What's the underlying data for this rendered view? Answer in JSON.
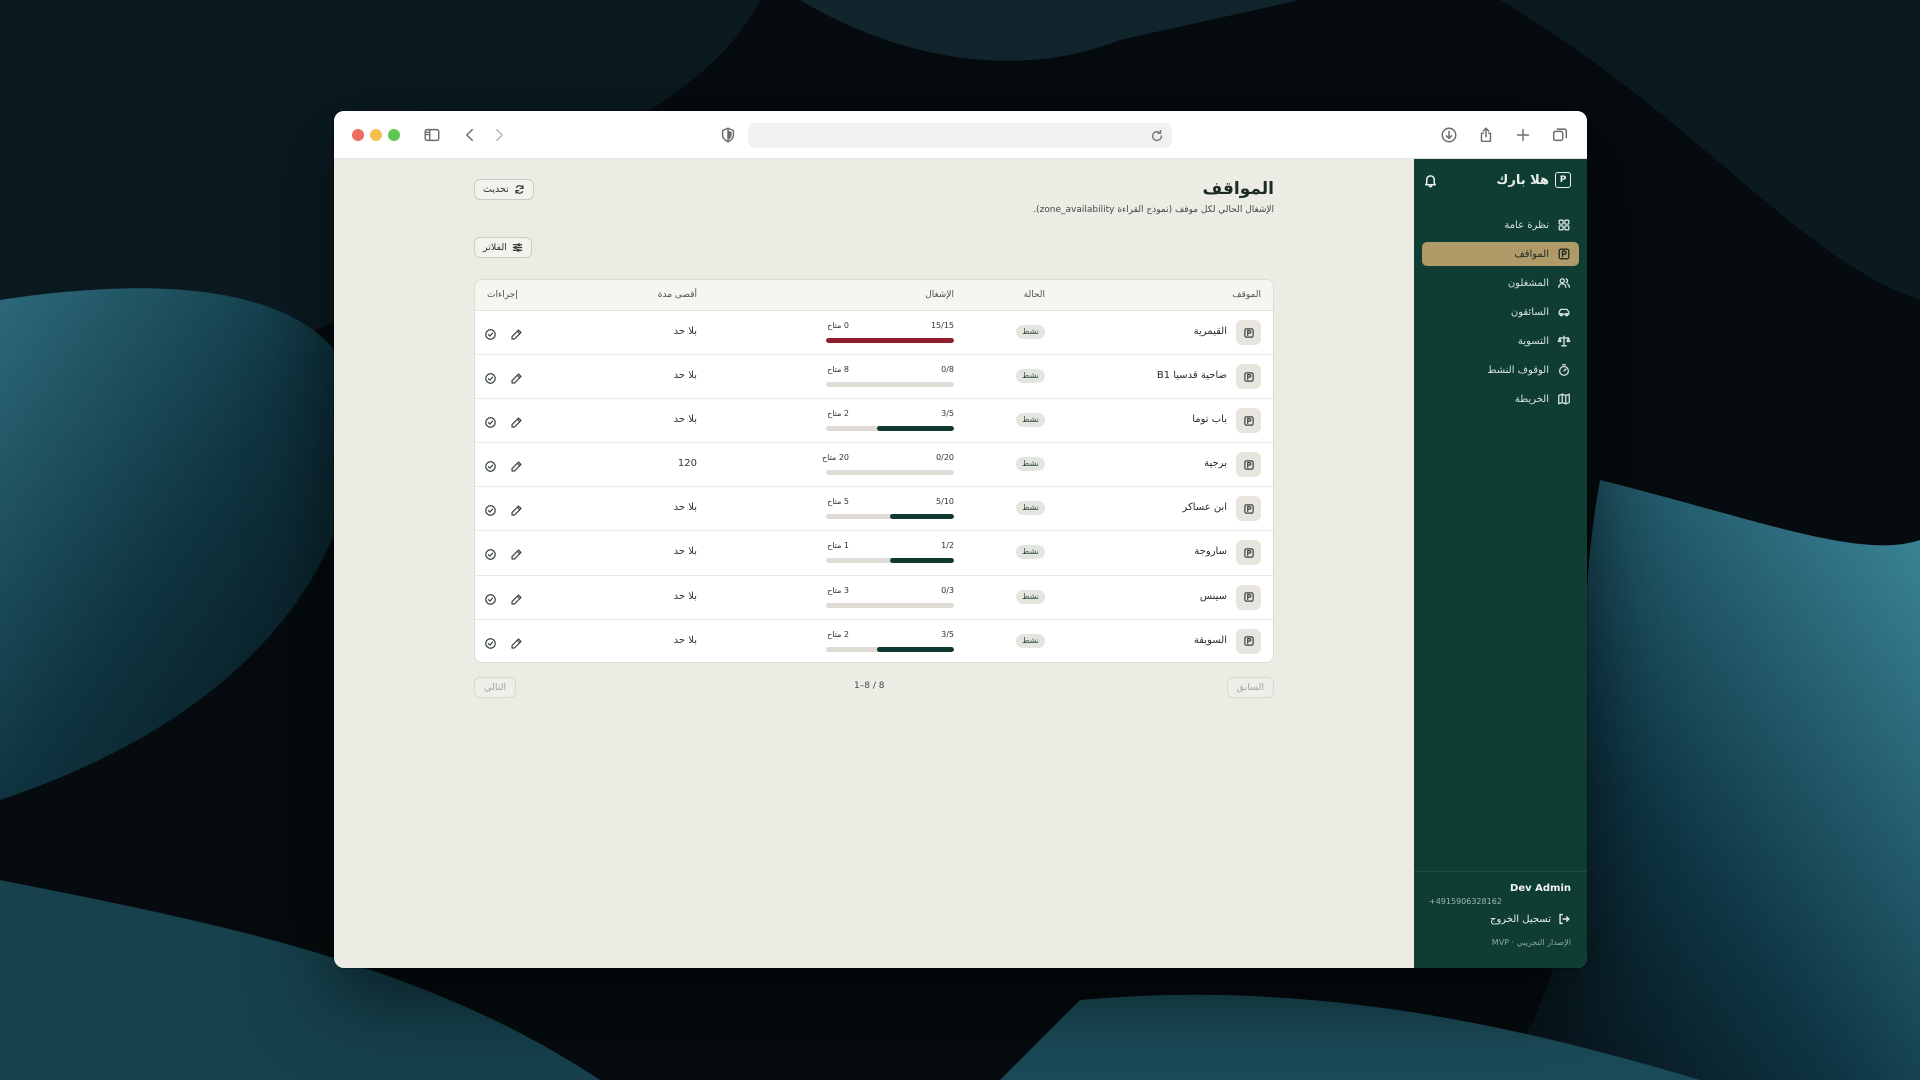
{
  "sidebar": {
    "brand": "هلا بارك",
    "brand_logo_letter": "P",
    "nav": [
      {
        "label": "نظرة عامة",
        "icon": "grid-icon",
        "active": false
      },
      {
        "label": "المواقف",
        "icon": "parking-icon",
        "active": true
      },
      {
        "label": "المشغلون",
        "icon": "users-icon",
        "active": false
      },
      {
        "label": "السائقون",
        "icon": "car-icon",
        "active": false
      },
      {
        "label": "التسوية",
        "icon": "scale-icon",
        "active": false
      },
      {
        "label": "الوقوف النشط",
        "icon": "timer-icon",
        "active": false
      },
      {
        "label": "الخريطة",
        "icon": "map-icon",
        "active": false
      }
    ],
    "user_name": "Dev Admin",
    "user_phone": "+4915906328162",
    "logout_label": "تسجيل الخروج",
    "version": "الإصدار التجريبي · MVP"
  },
  "page": {
    "title": "المواقف",
    "subtitle": "الإشغال الحالي لكل موقف (نموذج القراءة zone_availability).",
    "refresh_label": "تحديث",
    "filters_label": "الفلاتر"
  },
  "table": {
    "headers": {
      "zone": "الموقف",
      "status": "الحالة",
      "occupancy": "الإشغال",
      "max_duration": "أقصى مدة",
      "actions": "إجراءات"
    },
    "rows": [
      {
        "name": "القيمرية",
        "status": "نشط",
        "occupied": 15,
        "capacity": 15,
        "count_text": "15/15",
        "available_text": "0 متاح",
        "max_duration": "بلا حد"
      },
      {
        "name": "ضاحية قدسيا B1",
        "status": "نشط",
        "occupied": 0,
        "capacity": 8,
        "count_text": "0/8",
        "available_text": "8 متاح",
        "max_duration": "بلا حد"
      },
      {
        "name": "باب توما",
        "status": "نشط",
        "occupied": 3,
        "capacity": 5,
        "count_text": "3/5",
        "available_text": "2 متاح",
        "max_duration": "بلا حد"
      },
      {
        "name": "برجية",
        "status": "نشط",
        "occupied": 0,
        "capacity": 20,
        "count_text": "0/20",
        "available_text": "20 متاح",
        "max_duration": "120"
      },
      {
        "name": "ابن عساكر",
        "status": "نشط",
        "occupied": 5,
        "capacity": 10,
        "count_text": "5/10",
        "available_text": "5 متاح",
        "max_duration": "بلا حد"
      },
      {
        "name": "ساروجة",
        "status": "نشط",
        "occupied": 1,
        "capacity": 2,
        "count_text": "1/2",
        "available_text": "1 متاح",
        "max_duration": "بلا حد"
      },
      {
        "name": "سينس",
        "status": "نشط",
        "occupied": 0,
        "capacity": 3,
        "count_text": "0/3",
        "available_text": "3 متاح",
        "max_duration": "بلا حد"
      },
      {
        "name": "السويقة",
        "status": "نشط",
        "occupied": 3,
        "capacity": 5,
        "count_text": "3/5",
        "available_text": "2 متاح",
        "max_duration": "بلا حد"
      }
    ]
  },
  "pagination": {
    "prev_label": "السابق",
    "next_label": "التالي",
    "info": "1–8 / 8"
  },
  "colors": {
    "sidebar_bg": "#0f3d33",
    "active_item": "#b09a68",
    "bar_fill": "#0e3a31",
    "bar_full": "#8e1e2e",
    "content_bg": "#ecebe4"
  }
}
